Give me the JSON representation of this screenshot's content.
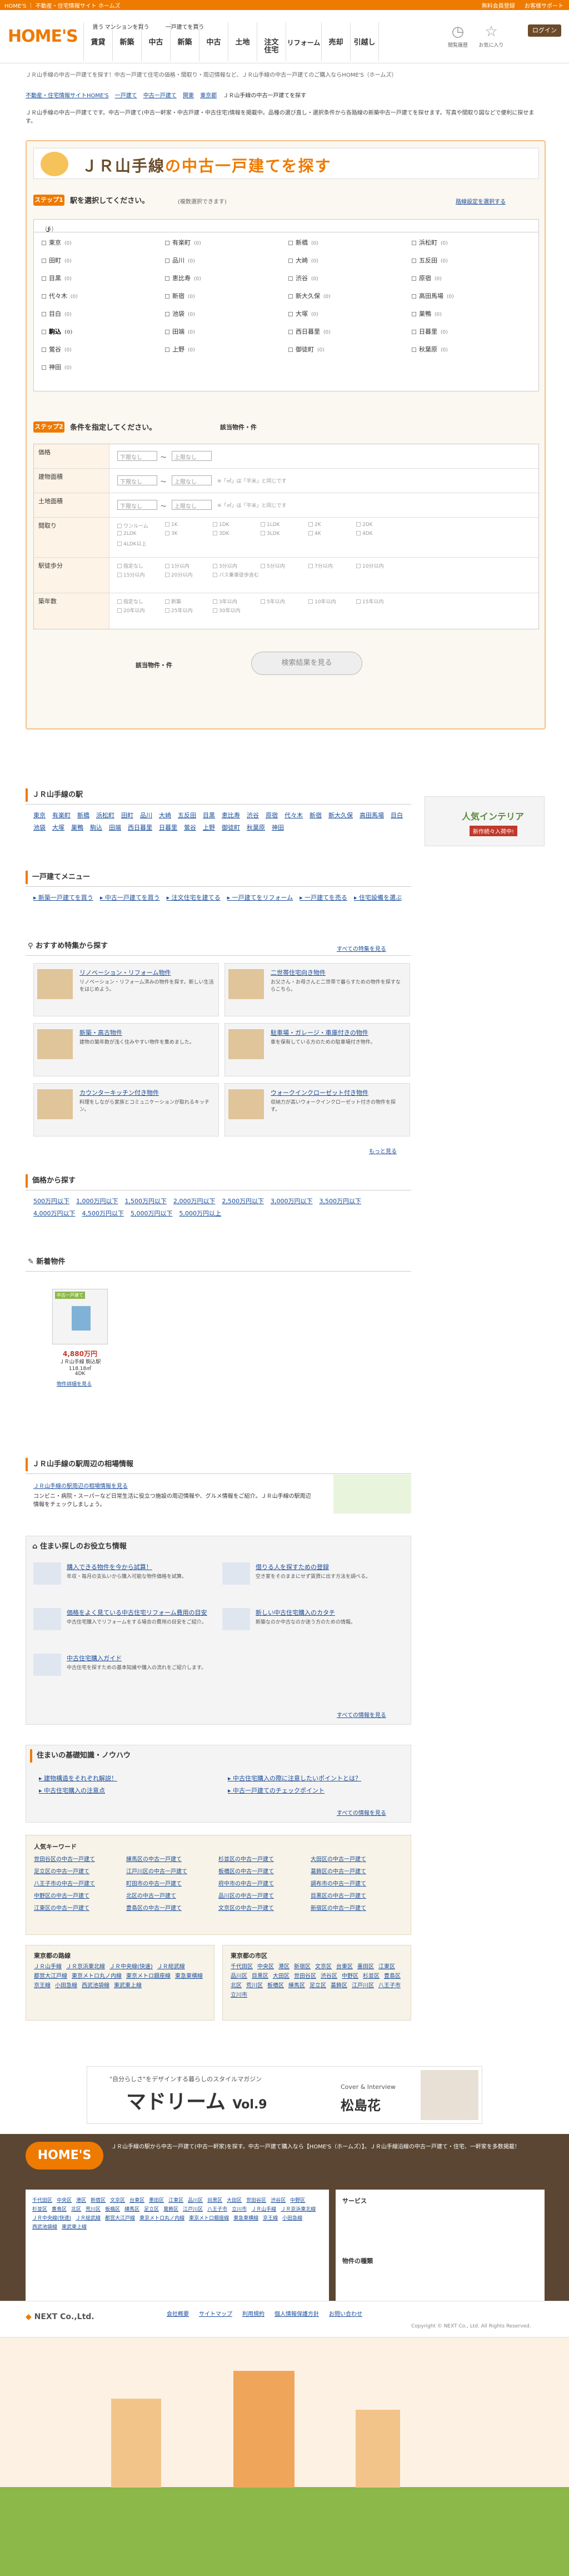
{
  "topbar": {
    "left": "HOME'S ｜ 不動産・住宅情報サイト ホームズ",
    "links": [
      "無料会員登録",
      "お客様サポート"
    ]
  },
  "header": {
    "logo": "HOME'S",
    "nav": [
      {
        "top": "賃う",
        "main": "賃貸"
      },
      {
        "top": "マンションを買う",
        "main": "新築"
      },
      {
        "top": "",
        "main": "中古"
      },
      {
        "top": "一戸建てを買う",
        "main": "新築"
      },
      {
        "top": "",
        "main": "中古"
      },
      {
        "top": "",
        "main": "土地"
      },
      {
        "top": "",
        "main": "注文住宅"
      },
      {
        "top": "",
        "main": "リフォーム"
      },
      {
        "top": "",
        "main": "売却"
      },
      {
        "top": "",
        "main": "引越し"
      }
    ],
    "icons": [
      {
        "label": "閲覧履歴"
      },
      {
        "label": "お気に入り"
      }
    ],
    "login": "ログイン"
  },
  "crumb1": "ＪＲ山手線の中古一戸建てを探す！中古一戸建て住宅の価格・間取り・周辺情報など、ＪＲ山手線の中古一戸建てのご購入ならHOME'S（ホームズ）",
  "crumb2": [
    "不動産・住宅情報サイトHOME'S",
    "一戸建て",
    "中古一戸建て",
    "関東",
    "東京都",
    "ＪＲ山手線の中古一戸建てを探す"
  ],
  "intro": "ＪＲ山手線の中古一戸建てです。中古一戸建て(中古一軒家・中古戸建・中古住宅)情報を掲載中。品種の選び直し・選択条件から各路線の新築中古一戸建てを探せます。写真や間取り図などで便利に探せます。",
  "panel": {
    "title_pre": "ＪＲ山手線",
    "title_post": "の中古一戸建てを探す",
    "step1": "ステップ1",
    "step1_desc": "駅を選択してください。",
    "step1_note": "(複数選択できます)",
    "step1_link": "路線設定を選択する",
    "line_name": "ＪＲ山手線",
    "line_count": "(6)",
    "stations": [
      [
        "東京",
        "(0)"
      ],
      [
        "有楽町",
        "(0)"
      ],
      [
        "新橋",
        "(0)"
      ],
      [
        "浜松町",
        "(0)"
      ],
      [
        "田町",
        "(0)"
      ],
      [
        "品川",
        "(0)"
      ],
      [
        "大崎",
        "(0)"
      ],
      [
        "五反田",
        "(0)"
      ],
      [
        "目黒",
        "(0)"
      ],
      [
        "恵比寿",
        "(0)"
      ],
      [
        "渋谷",
        "(0)"
      ],
      [
        "原宿",
        "(0)"
      ],
      [
        "代々木",
        "(0)"
      ],
      [
        "新宿",
        "(0)"
      ],
      [
        "新大久保",
        "(0)"
      ],
      [
        "高田馬場",
        "(0)"
      ],
      [
        "目白",
        "(0)"
      ],
      [
        "池袋",
        "(0)"
      ],
      [
        "大塚",
        "(0)"
      ],
      [
        "巣鴨",
        "(0)"
      ],
      [
        "駒込",
        "(0)"
      ],
      [
        "田端",
        "(0)"
      ],
      [
        "西日暮里",
        "(0)"
      ],
      [
        "日暮里",
        "(0)"
      ],
      [
        "鶯谷",
        "(0)"
      ],
      [
        "上野",
        "(0)"
      ],
      [
        "御徒町",
        "(0)"
      ],
      [
        "秋葉原",
        "(0)"
      ],
      [
        "神田",
        "(0)"
      ]
    ],
    "step2": "ステップ2",
    "step2_desc": "条件を指定してください。",
    "step2_hits": "該当物件・件",
    "rows": [
      {
        "label": "価格",
        "sel1": "下限なし",
        "sel2": "上限なし",
        "note": ""
      },
      {
        "label": "建物面積",
        "sel1": "下限なし",
        "sel2": "上限なし",
        "note": "※「㎡」は「平米」と同じです"
      },
      {
        "label": "土地面積",
        "sel1": "下限なし",
        "sel2": "上限なし",
        "note": "※「㎡」は「平米」と同じです"
      },
      {
        "label": "間取り",
        "sel1": "",
        "sel2": "",
        "note": ""
      },
      {
        "label": "駅徒歩分",
        "sel1": "",
        "sel2": "",
        "note": ""
      },
      {
        "label": "築年数",
        "sel1": "",
        "sel2": "",
        "note": ""
      }
    ],
    "madori": [
      "ワンルーム",
      "1K",
      "1DK",
      "1LDK",
      "2K",
      "2DK",
      "2LDK",
      "3K",
      "3DK",
      "3LDK",
      "4K",
      "4DK",
      "4LDK以上"
    ],
    "walk": [
      "指定なし",
      "1分以内",
      "3分以内",
      "5分以内",
      "7分以内",
      "10分以内",
      "15分以内",
      "20分以内",
      "バス乗車徒歩含む"
    ],
    "age": [
      "指定なし",
      "新築",
      "3年以内",
      "5年以内",
      "10年以内",
      "15年以内",
      "20年以内",
      "25年以内",
      "30年以内"
    ],
    "hits": "該当物件・件",
    "search_btn": "検索結果を見る"
  },
  "stations_sec": {
    "title": "ＪＲ山手線の駅",
    "items": [
      "東京",
      "有楽町",
      "新橋",
      "浜松町",
      "田町",
      "品川",
      "大崎",
      "五反田",
      "目黒",
      "恵比寿",
      "渋谷",
      "原宿",
      "代々木",
      "新宿",
      "新大久保",
      "高田馬場",
      "目白",
      "池袋",
      "大塚",
      "巣鴨",
      "駒込",
      "田端",
      "西日暮里",
      "日暮里",
      "鶯谷",
      "上野",
      "御徒町",
      "秋葉原",
      "神田"
    ]
  },
  "menu_sec": {
    "title": "一戸建てメニュー",
    "items": [
      "新築一戸建てを買う",
      "中古一戸建てを買う",
      "注文住宅を建てる",
      "一戸建てをリフォーム",
      "一戸建てを売る",
      "住宅設備を選ぶ"
    ]
  },
  "special_sec": {
    "title": "おすすめ特集から探す",
    "more": "すべての特集を見る",
    "cards": [
      {
        "t": "リノベーション・リフォーム物件",
        "d": "リノベーション・リフォーム済みの物件を探す。新しい生活をはじめよう。"
      },
      {
        "t": "二世帯住宅向き物件",
        "d": "お父さん・お母さんと二世帯で暮らすための物件を探すならこちら。"
      },
      {
        "t": "新築・高古物件",
        "d": "建物の築年数が浅く住みやすい物件を集めました。"
      },
      {
        "t": "駐車場・ガレージ・車庫付きの物件",
        "d": "車を保有している方のための駐車場付き物件。"
      },
      {
        "t": "カウンターキッチン付き物件",
        "d": "料理をしながら家族とコミュニケーションが取れるキッチン。"
      },
      {
        "t": "ウォークインクローゼット付き物件",
        "d": "収納力が高いウォークインクローゼット付きの物件を探す。"
      }
    ],
    "pagelink": "もっと見る"
  },
  "price_sec": {
    "title": "価格から探す",
    "items": [
      "500万円以下",
      "1,000万円以下",
      "1,500万円以下",
      "2,000万円以下",
      "2,500万円以下",
      "3,000万円以下",
      "3,500万円以下",
      "4,000万円以下",
      "4,500万円以下",
      "5,000万円以下",
      "5,000万円以上"
    ]
  },
  "new_sec": {
    "title": "新着物件",
    "badge": "中古一戸建て",
    "price": "4,880万円",
    "station": "ＪＲ山手線 駒込駅",
    "area": "118.18㎡",
    "madori": "4DK",
    "link": "物件詳細を見る"
  },
  "area_sec": {
    "title": "ＪＲ山手線の駅周辺の相場情報",
    "link": "ＪＲ山手線の駅周辺の相場情報を見る",
    "desc": "コンビニ・病院・スーパーなど日常生活に役立つ施設の周辺情報や、グルメ情報をご紹介。ＪＲ山手線の駅周辺情報をチェックしましょう。"
  },
  "help_sec": {
    "title": "住まい探しのお役立ち情報",
    "items": [
      {
        "t": "購入できる物件を今から試算！",
        "d": "年収・毎月の支払いから購入可能な物件価格を試算。"
      },
      {
        "t": "借りる人を探すための登録",
        "d": "空き家をそのままにせず賃貸に出す方法を調べる。"
      },
      {
        "t": "価格をよく見ている中古住宅リフォーム費用の目安",
        "d": "中古住宅購入でリフォームをする場合の費用の目安をご紹介。"
      },
      {
        "t": "新しい中古住宅購入のカタチ",
        "d": "新築なのか中古なのか迷う方のための情報。"
      },
      {
        "t": "中古住宅購入ガイド",
        "d": "中古住宅を探すための基本知識や購入の流れをご紹介します。"
      }
    ],
    "more": "すべての情報を見る"
  },
  "knowhow_sec": {
    "title": "住まいの基礎知識・ノウハウ",
    "items": [
      "建物構造をそれぞれ解説！",
      "中古住宅購入の注意点",
      "中古住宅購入の際に注意したいポイントとは？",
      "中古一戸建てのチェックポイント"
    ],
    "more": "すべての情報を見る"
  },
  "keywords": {
    "title": "人気キーワード",
    "items": [
      "世田谷区の中古一戸建て",
      "練馬区の中古一戸建て",
      "杉並区の中古一戸建て",
      "大田区の中古一戸建て",
      "足立区の中古一戸建て",
      "江戸川区の中古一戸建て",
      "板橋区の中古一戸建て",
      "葛飾区の中古一戸建て",
      "八王子市の中古一戸建て",
      "町田市の中古一戸建て",
      "府中市の中古一戸建て",
      "調布市の中古一戸建て",
      "中野区の中古一戸建て",
      "北区の中古一戸建て",
      "品川区の中古一戸建て",
      "目黒区の中古一戸建て",
      "江東区の中古一戸建て",
      "豊島区の中古一戸建て",
      "文京区の中古一戸建て",
      "新宿区の中古一戸建て"
    ]
  },
  "railways": {
    "title": "東京都の路線",
    "items": [
      "ＪＲ山手線",
      "ＪＲ京浜東北線",
      "ＪＲ中央線(快速)",
      "ＪＲ総武線",
      "都営大江戸線",
      "東京メトロ丸ノ内線",
      "東京メトロ銀座線",
      "東急東横線",
      "京王線",
      "小田急線",
      "西武池袋線",
      "東武東上線"
    ]
  },
  "cities": {
    "title": "東京都の市区",
    "items": [
      "千代田区",
      "中央区",
      "港区",
      "新宿区",
      "文京区",
      "台東区",
      "墨田区",
      "江東区",
      "品川区",
      "目黒区",
      "大田区",
      "世田谷区",
      "渋谷区",
      "中野区",
      "杉並区",
      "豊島区",
      "北区",
      "荒川区",
      "板橋区",
      "練馬区",
      "足立区",
      "葛飾区",
      "江戸川区",
      "八王子市",
      "立川市"
    ]
  },
  "magazine": {
    "tag": "\"自分らしさ\"をデザインする暮らしのスタイルマガジン",
    "name": "マドリーム",
    "vol": "Vol.9",
    "cover": "Cover & Interview",
    "person": "松島花"
  },
  "banner": {
    "title": "人気インテリア",
    "sub": "新作続々入荷中!"
  },
  "footer": {
    "logo": "HOME'S",
    "desc": "ＪＲ山手線の駅から中古一戸建て(中古一軒家)を探す。中古一戸建て購入なら【HOME'S（ホームズ）】。ＪＲ山手線沿線の中古一戸建て・住宅、一軒家を多数掲載！",
    "services_title": "サービス",
    "props_title": "物件の種類",
    "corp": "NEXT Co.,Ltd.",
    "links": [
      "会社概要",
      "サイトマップ",
      "利用規約",
      "個人情報保護方針",
      "お問い合わせ"
    ],
    "copyright": "Copyright © NEXT Co., Ltd. All Rights Reserved."
  }
}
